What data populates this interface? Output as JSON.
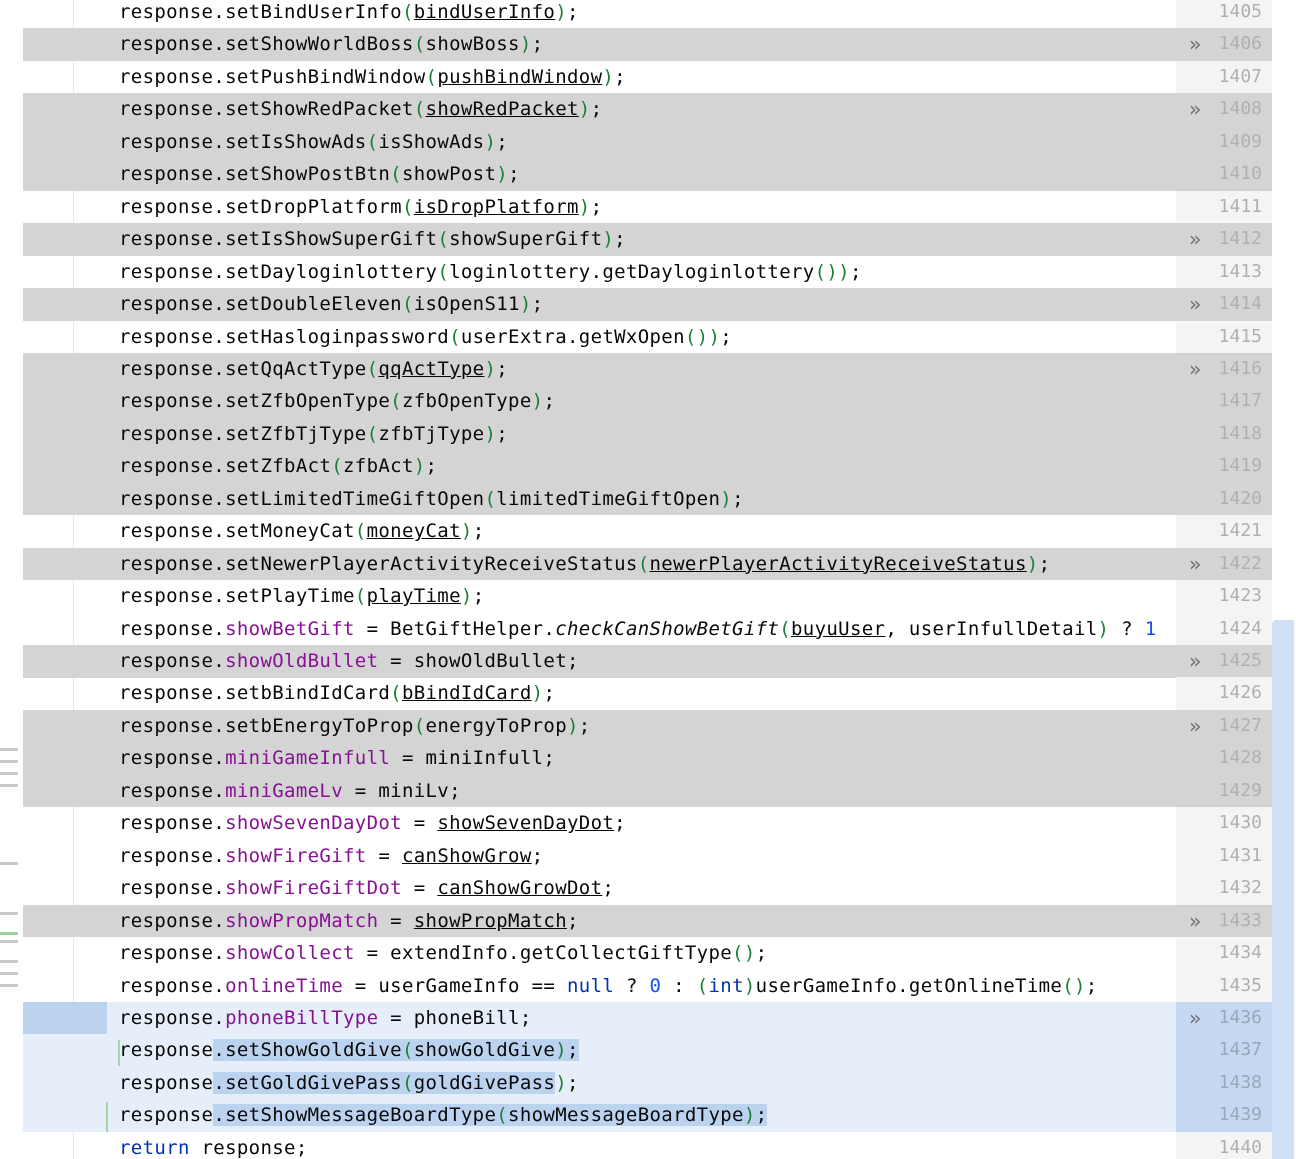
{
  "editor": {
    "lines": [
      {
        "num": "1405",
        "diff": false,
        "fold": false,
        "html": "response.setBindUserInfo<span class=\"brk\">(</span><span class=\"u\">bindUserInfo</span><span class=\"brk\">)</span>;"
      },
      {
        "num": "1406",
        "diff": true,
        "fold": true,
        "html": "response.setShowWorldBoss<span class=\"brk\">(</span>showBoss<span class=\"brk\">)</span>;"
      },
      {
        "num": "1407",
        "diff": false,
        "fold": false,
        "html": "response.setPushBindWindow<span class=\"brk\">(</span><span class=\"u\">pushBindWindow</span><span class=\"brk\">)</span>;"
      },
      {
        "num": "1408",
        "diff": true,
        "fold": true,
        "html": "response.setShowRedPacket<span class=\"brk\">(</span><span class=\"u\">showRedPacket</span><span class=\"brk\">)</span>;"
      },
      {
        "num": "1409",
        "diff": true,
        "fold": false,
        "html": "response.setIsShowAds<span class=\"brk\">(</span>isShowAds<span class=\"brk\">)</span>;"
      },
      {
        "num": "1410",
        "diff": true,
        "fold": false,
        "html": "response.setShowPostBtn<span class=\"brk\">(</span>showPost<span class=\"brk\">)</span>;"
      },
      {
        "num": "1411",
        "diff": false,
        "fold": false,
        "html": "response.setDropPlatform<span class=\"brk\">(</span><span class=\"u\">isDropPlatform</span><span class=\"brk\">)</span>;"
      },
      {
        "num": "1412",
        "diff": true,
        "fold": true,
        "html": "response.setIsShowSuperGift<span class=\"brk\">(</span>showSuperGift<span class=\"brk\">)</span>;"
      },
      {
        "num": "1413",
        "diff": false,
        "fold": false,
        "html": "response.setDayloginlottery<span class=\"brk\">(</span>loginlottery.getDayloginlottery<span class=\"brk\">()</span><span class=\"brk\">)</span>;"
      },
      {
        "num": "1414",
        "diff": true,
        "fold": true,
        "html": "response.setDoubleEleven<span class=\"brk\">(</span>isOpenS11<span class=\"brk\">)</span>;"
      },
      {
        "num": "1415",
        "diff": false,
        "fold": false,
        "html": "response.setHasloginpassword<span class=\"brk\">(</span>userExtra.getWxOpen<span class=\"brk\">()</span><span class=\"brk\">)</span>;"
      },
      {
        "num": "1416",
        "diff": true,
        "fold": true,
        "html": "response.setQqActType<span class=\"brk\">(</span><span class=\"u\">qqActType</span><span class=\"brk\">)</span>;"
      },
      {
        "num": "1417",
        "diff": true,
        "fold": false,
        "html": "response.setZfbOpenType<span class=\"brk\">(</span>zfbOpenType<span class=\"brk\">)</span>;"
      },
      {
        "num": "1418",
        "diff": true,
        "fold": false,
        "html": "response.setZfbTjType<span class=\"brk\">(</span>zfbTjType<span class=\"brk\">)</span>;"
      },
      {
        "num": "1419",
        "diff": true,
        "fold": false,
        "html": "response.setZfbAct<span class=\"brk\">(</span>zfbAct<span class=\"brk\">)</span>;"
      },
      {
        "num": "1420",
        "diff": true,
        "fold": false,
        "html": "response.setLimitedTimeGiftOpen<span class=\"brk\">(</span>limitedTimeGiftOpen<span class=\"brk\">)</span>;"
      },
      {
        "num": "1421",
        "diff": false,
        "fold": false,
        "html": "response.setMoneyCat<span class=\"brk\">(</span><span class=\"u\">moneyCat</span><span class=\"brk\">)</span>;"
      },
      {
        "num": "1422",
        "diff": true,
        "fold": true,
        "html": "response.setNewerPlayerActivityReceiveStatus<span class=\"brk\">(</span><span class=\"u\">newerPlayerActivityReceiveStatus</span><span class=\"brk\">)</span>;"
      },
      {
        "num": "1423",
        "diff": false,
        "fold": false,
        "html": "response.setPlayTime<span class=\"brk\">(</span><span class=\"u\">playTime</span><span class=\"brk\">)</span>;"
      },
      {
        "num": "1424",
        "diff": false,
        "fold": false,
        "html": "response.<span class=\"fld\">showBetGift</span> = BetGiftHelper.<span class=\"it\">checkCanShowBetGift</span><span class=\"brk\">(</span><span class=\"u\">buyuUser</span>, userInfullDetail<span class=\"brk\">)</span> ? <span class=\"num\">1</span>"
      },
      {
        "num": "1425",
        "diff": true,
        "fold": true,
        "html": "response.<span class=\"fld\">showOldBullet</span> = showOldBullet;"
      },
      {
        "num": "1426",
        "diff": false,
        "fold": false,
        "html": "response.setbBindIdCard<span class=\"brk\">(</span><span class=\"u\">bBindIdCard</span><span class=\"brk\">)</span>;"
      },
      {
        "num": "1427",
        "diff": true,
        "fold": true,
        "html": "response.setbEnergyToProp<span class=\"brk\">(</span>energyToProp<span class=\"brk\">)</span>;"
      },
      {
        "num": "1428",
        "diff": true,
        "fold": false,
        "html": "response.<span class=\"fld\">miniGameInfull</span> = miniInfull;"
      },
      {
        "num": "1429",
        "diff": true,
        "fold": false,
        "html": "response.<span class=\"fld\">miniGameLv</span> = miniLv;"
      },
      {
        "num": "1430",
        "diff": false,
        "fold": false,
        "html": "response.<span class=\"fld\">showSevenDayDot</span> = <span class=\"u\">showSevenDayDot</span>;"
      },
      {
        "num": "1431",
        "diff": false,
        "fold": false,
        "html": "response.<span class=\"fld\">showFireGift</span> = <span class=\"u\">canShowGrow</span>;"
      },
      {
        "num": "1432",
        "diff": false,
        "fold": false,
        "html": "response.<span class=\"fld\">showFireGiftDot</span> = <span class=\"u\">canShowGrowDot</span>;"
      },
      {
        "num": "1433",
        "diff": true,
        "fold": true,
        "html": "response.<span class=\"fld\">showPropMatch</span> = <span class=\"u\">showPropMatch</span>;"
      },
      {
        "num": "1434",
        "diff": false,
        "fold": false,
        "html": "response.<span class=\"fld\">showCollect</span> = extendInfo.getCollectGiftType<span class=\"brk\">()</span>;"
      },
      {
        "num": "1435",
        "diff": false,
        "fold": false,
        "html": "response.<span class=\"fld\">onlineTime</span> = userGameInfo == <span class=\"kw\">null</span> ? <span class=\"num\">0</span> : <span class=\"brk\">(</span><span class=\"kw\">int</span><span class=\"brk\">)</span>userGameInfo.getOnlineTime<span class=\"brk\">()</span>;"
      },
      {
        "num": "1436",
        "diff": false,
        "sel": true,
        "fold": true,
        "html": "response.<span class=\"fld\">phoneBillType</span> = phoneBill;"
      },
      {
        "num": "1437",
        "diff": false,
        "sel": true,
        "fold": false,
        "html": "response<span class=\"sel-text\">.setShowGoldGive<span class=\"brk\">(</span>showGoldGive<span class=\"brk\">)</span>;</span>"
      },
      {
        "num": "1438",
        "diff": false,
        "sel": true,
        "fold": false,
        "html": "response<span class=\"sel-text\">.setGoldGivePass<span class=\"brk\">(</span>goldGivePass</span><span class=\"brk\">)</span>;"
      },
      {
        "num": "1439",
        "diff": false,
        "sel": true,
        "fold": false,
        "html": "response<span class=\"sel-text\">.setShowMessageBoardType<span class=\"brk\">(</span>showMessageBoardType<span class=\"brk\">)</span>;</span>"
      },
      {
        "num": "1440",
        "diff": false,
        "fold": false,
        "html": "<span class=\"kw\">return</span> response;"
      }
    ],
    "fold_icon_name": "fold-arrows-icon"
  }
}
